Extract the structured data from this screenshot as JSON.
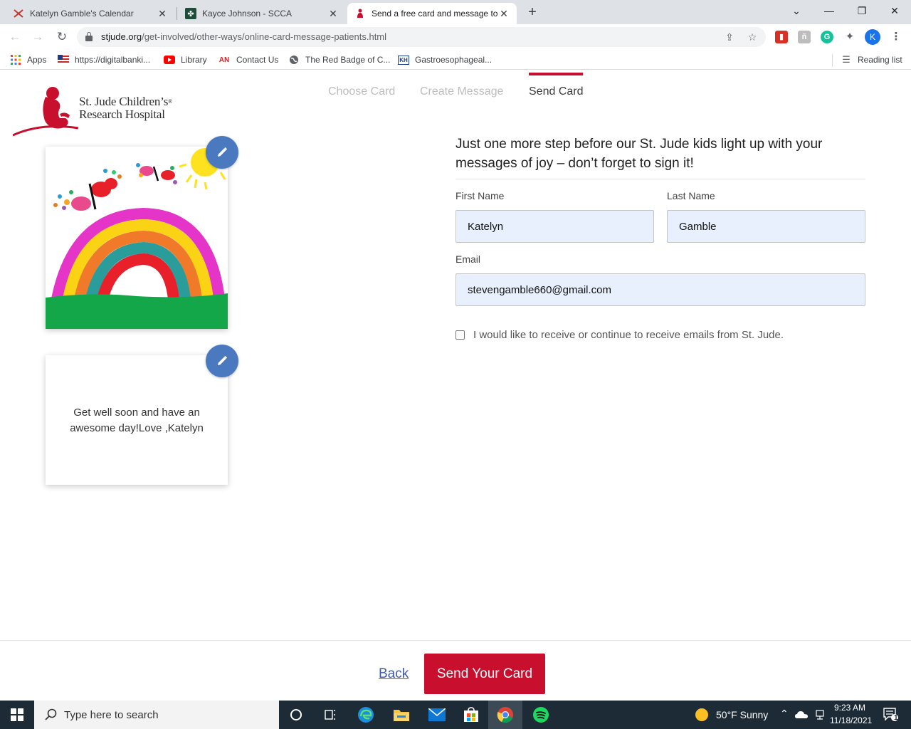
{
  "browser": {
    "tabs": [
      {
        "title": "Katelyn Gamble's Calendar",
        "icon": "calendar-x-icon",
        "active": false
      },
      {
        "title": "Kayce Johnson - SCCA",
        "icon": "scca-icon",
        "active": false
      },
      {
        "title": "Send a free card and message to",
        "icon": "stjude-icon",
        "active": true
      }
    ],
    "url_host": "stjude.org",
    "url_path": "/get-involved/other-ways/online-card-message-patients.html",
    "profile_initial": "K",
    "bookmarks": [
      {
        "label": "Apps",
        "icon": "apps-grid-icon"
      },
      {
        "label": "https://digitalbanki...",
        "icon": "bank-flag-icon"
      },
      {
        "label": "Library",
        "icon": "youtube-icon"
      },
      {
        "label": "Contact Us",
        "icon": "an-icon"
      },
      {
        "label": "The Red Badge of C...",
        "icon": "globe-icon"
      },
      {
        "label": "Gastroesophageal...",
        "icon": "kh-icon"
      }
    ],
    "reading_list": "Reading list"
  },
  "site": {
    "logo_line1": "St. Jude Children’s",
    "logo_line2": "Research Hospital",
    "logo_reg": "®",
    "brand_color": "#c8102e"
  },
  "steps": [
    {
      "label": "Choose Card",
      "active": false
    },
    {
      "label": "Create Message",
      "active": false
    },
    {
      "label": "Send Card",
      "active": true
    }
  ],
  "card": {
    "message": "Get well soon and have an awesome day!Love ,Katelyn"
  },
  "form": {
    "heading": "Just one more step before our St. Jude kids light up with your messages of joy – don’t forget to sign it!",
    "first_name_label": "First Name",
    "first_name_value": "Katelyn",
    "last_name_label": "Last Name",
    "last_name_value": "Gamble",
    "email_label": "Email",
    "email_value": "stevengamble660@gmail.com",
    "optin_label": "I would like to receive or continue to receive emails from St. Jude.",
    "optin_checked": false
  },
  "footer": {
    "back_label": "Back",
    "send_label": "Send Your Card"
  },
  "taskbar": {
    "search_placeholder": "Type here to search",
    "weather": "50°F  Sunny",
    "time": "9:23 AM",
    "date": "11/18/2021",
    "notification_count": "1"
  }
}
